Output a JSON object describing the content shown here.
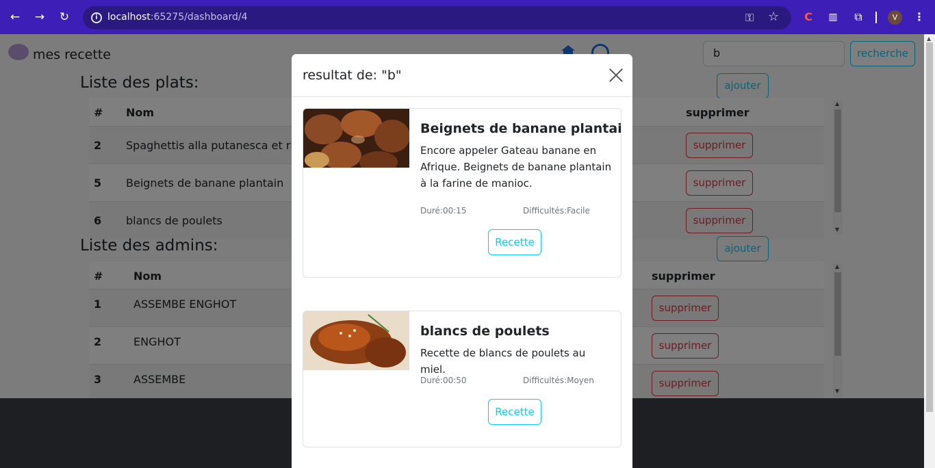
{
  "browser": {
    "url_host": "localhost",
    "url_rest": ":65275/dashboard/4",
    "avatar_letter": "V"
  },
  "header": {
    "brand": "mes recette",
    "search_value": "b",
    "search_button": "recherche"
  },
  "plats": {
    "title": "Liste des plats:",
    "add_label": "ajouter",
    "columns": [
      "#",
      "Nom",
      "supprimer"
    ],
    "rows": [
      {
        "id": "2",
        "name": "Spaghettis alla putanesca et ricotta",
        "action": "supprimer"
      },
      {
        "id": "5",
        "name": "Beignets de banane plantain",
        "action": "supprimer"
      },
      {
        "id": "6",
        "name": "blancs de poulets",
        "action": "supprimer"
      }
    ]
  },
  "admins": {
    "title": "Liste des admins:",
    "add_label": "ajouter",
    "columns": [
      "#",
      "Nom",
      "supprimer"
    ],
    "rows": [
      {
        "id": "1",
        "name": "ASSEMBE ENGHOT",
        "action": "supprimer"
      },
      {
        "id": "2",
        "name": "ENGHOT",
        "action": "supprimer"
      },
      {
        "id": "3",
        "name": "ASSEMBE",
        "action": "supprimer"
      }
    ]
  },
  "modal": {
    "title": "resultat de: \"b\"",
    "results": [
      {
        "title": "Beignets de banane plantain",
        "description": "Encore appeler Gateau banane en Afrique. Beignets de banane plantain à la farine de manioc.",
        "duration": "Duré:00:15",
        "difficulty": "Difficultés:Facile",
        "button": "Recette"
      },
      {
        "title": "blancs de poulets",
        "description": "Recette de blancs de poulets au miel.",
        "duration": "Duré:00:50",
        "difficulty": "Difficultés:Moyen",
        "button": "Recette"
      }
    ]
  }
}
